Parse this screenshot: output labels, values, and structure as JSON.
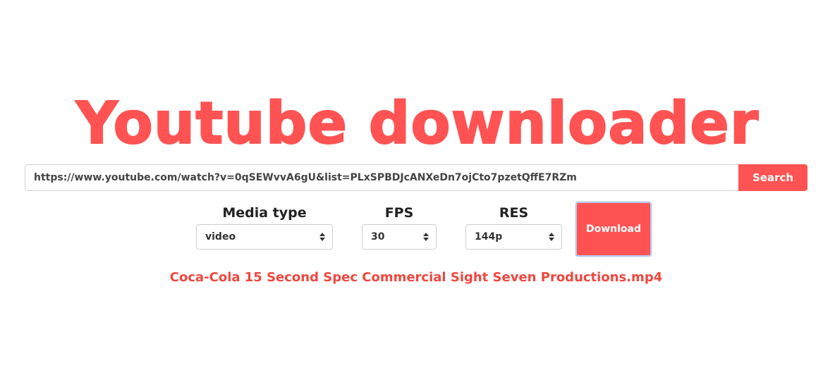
{
  "header": {
    "title": "Youtube downloader"
  },
  "search": {
    "url_value": "https://www.youtube.com/watch?v=0qSEWvvA6gU&list=PLxSPBDJcANXeDn7ojCto7pzetQffE7RZm",
    "button_label": "Search"
  },
  "options": {
    "media_type": {
      "label": "Media type",
      "selected": "video"
    },
    "fps": {
      "label": "FPS",
      "selected": "30"
    },
    "res": {
      "label": "RES",
      "selected": "144p"
    }
  },
  "actions": {
    "download_label": "Download"
  },
  "result": {
    "filename": "Coca-Cola 15 Second Spec Commercial Sight Seven Productions.mp4"
  },
  "colors": {
    "accent": "#ff5353",
    "filename_text": "#f0473f",
    "focus_ring": "#b9c9ee"
  },
  "icons": {
    "select_arrows": "sort-arrows-icon"
  }
}
